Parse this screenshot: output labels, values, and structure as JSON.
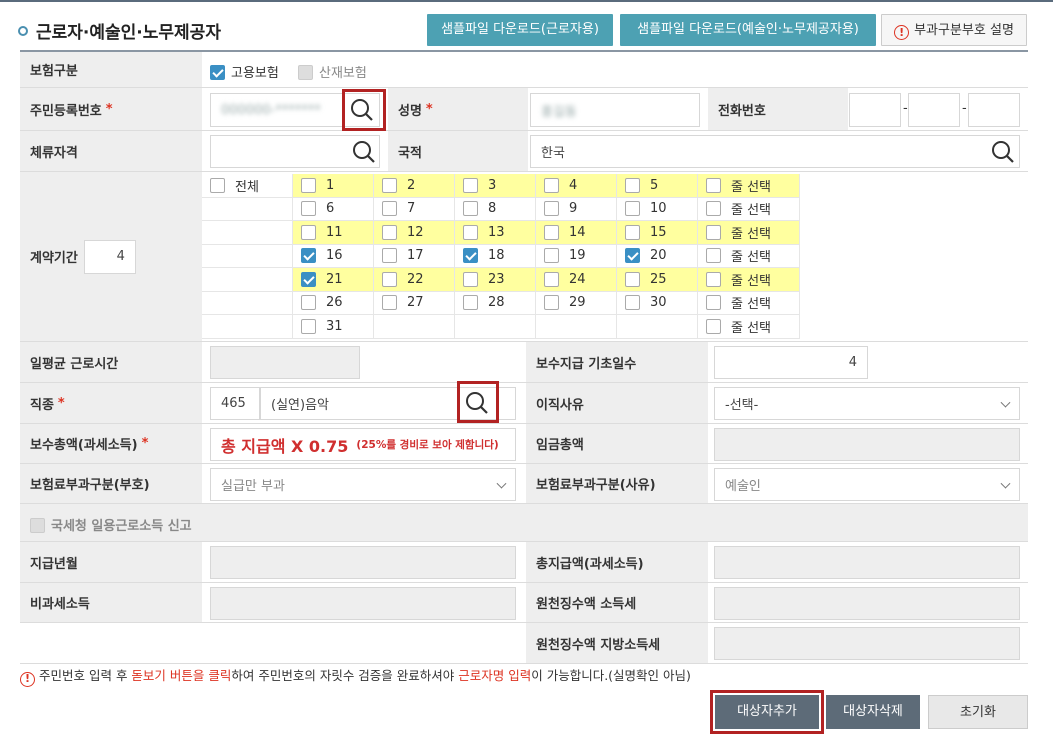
{
  "header": {
    "title": "근로자·예술인·노무제공자",
    "btn_sample_worker": "샘플파일 다운로드(근로자용)",
    "btn_sample_artist": "샘플파일 다운로드(예술인·노무제공자용)",
    "btn_help": "부과구분부호 설명"
  },
  "form": {
    "insurance_type": {
      "label": "보험구분",
      "employment": "고용보험",
      "industrial": "산재보험"
    },
    "resident_no": {
      "label": "주민등록번호",
      "value": "000000-*******"
    },
    "name": {
      "label": "성명",
      "value": "홍길동"
    },
    "phone": {
      "label": "전화번호",
      "dash": "-"
    },
    "stay_status": {
      "label": "체류자격"
    },
    "nationality": {
      "label": "국적",
      "value": "한국"
    },
    "contract": {
      "label": "계약기간",
      "count": "4",
      "all_label": "전체",
      "row_select": "줄 선택",
      "days": [
        [
          "1",
          "2",
          "3",
          "4",
          "5"
        ],
        [
          "6",
          "7",
          "8",
          "9",
          "10"
        ],
        [
          "11",
          "12",
          "13",
          "14",
          "15"
        ],
        [
          "16",
          "17",
          "18",
          "19",
          "20"
        ],
        [
          "21",
          "22",
          "23",
          "24",
          "25"
        ],
        [
          "26",
          "27",
          "28",
          "29",
          "30"
        ],
        [
          "31"
        ]
      ],
      "checked": [
        "16",
        "18",
        "20",
        "21"
      ]
    },
    "avg_hours": {
      "label": "일평균 근로시간"
    },
    "base_days": {
      "label": "보수지급 기초일수",
      "value": "4"
    },
    "job": {
      "label": "직종",
      "code": "465",
      "name": "(실연)음악"
    },
    "leave_reason": {
      "label": "이직사유",
      "value": "-선택-"
    },
    "pay_total": {
      "label": "보수총액(과세소득)",
      "formula": "총 지급액 X 0.75",
      "note": "(25%를 경비로 보아 제함니다)"
    },
    "wage_total": {
      "label": "임금총액"
    },
    "premium_code": {
      "label": "보험료부과구분(부호)",
      "value": "실급만 부과"
    },
    "premium_reason": {
      "label": "보험료부과구분(사유)",
      "value": "예술인"
    },
    "nts_report": {
      "label": "국세청 일용근로소득 신고"
    },
    "pay_month": {
      "label": "지급년월"
    },
    "total_pay": {
      "label": "총지급액(과세소득)"
    },
    "nontax": {
      "label": "비과세소득"
    },
    "withholding_income": {
      "label": "원천징수액 소득세"
    },
    "withholding_local": {
      "label": "원천징수액 지방소득세"
    }
  },
  "note": {
    "part1": "주민번호 입력 후 ",
    "part2": "돋보기 버튼을 클릭",
    "part3": "하여 주민번호의 자릿수 검증을 완료하셔야 ",
    "part4": "근로자명 입력",
    "part5": "이 가능합니다.(실명확인 아님)"
  },
  "footer": {
    "add": "대상자추가",
    "delete": "대상자삭제",
    "reset": "초기화"
  },
  "colors": {
    "accent": "#4da1b3",
    "highlight": "#ffff9f",
    "alert": "#d32f2f",
    "button_dark": "#5d6b78"
  }
}
